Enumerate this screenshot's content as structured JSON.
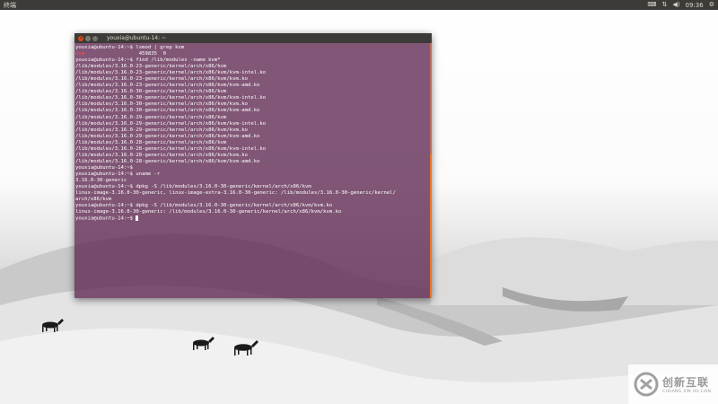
{
  "top_panel": {
    "app_name": "终端",
    "time": "09:36",
    "icons": [
      "keyboard-icon",
      "network-icon",
      "volume-icon",
      "power-icon"
    ]
  },
  "terminal": {
    "title": "youxia@ubuntu-14: ~",
    "lines": [
      {
        "parts": [
          {
            "t": "youxia@ubuntu-14:~$ lsmod | grep kvm"
          }
        ]
      },
      {
        "parts": [
          {
            "t": "kvm",
            "hl": true
          },
          {
            "t": "                  459835  0"
          }
        ]
      },
      {
        "parts": [
          {
            "t": "youxia@ubuntu-14:~$ find /lib/modules -name kvm*"
          }
        ]
      },
      {
        "parts": [
          {
            "t": "/lib/modules/3.16.0-23-generic/kernel/arch/x86/kvm"
          }
        ]
      },
      {
        "parts": [
          {
            "t": "/lib/modules/3.16.0-23-generic/kernel/arch/x86/kvm/kvm-intel.ko"
          }
        ]
      },
      {
        "parts": [
          {
            "t": "/lib/modules/3.16.0-23-generic/kernel/arch/x86/kvm/kvm.ko"
          }
        ]
      },
      {
        "parts": [
          {
            "t": "/lib/modules/3.16.0-23-generic/kernel/arch/x86/kvm/kvm-amd.ko"
          }
        ]
      },
      {
        "parts": [
          {
            "t": "/lib/modules/3.16.0-30-generic/kernel/arch/x86/kvm"
          }
        ]
      },
      {
        "parts": [
          {
            "t": "/lib/modules/3.16.0-30-generic/kernel/arch/x86/kvm/kvm-intel.ko"
          }
        ]
      },
      {
        "parts": [
          {
            "t": "/lib/modules/3.16.0-30-generic/kernel/arch/x86/kvm/kvm.ko"
          }
        ]
      },
      {
        "parts": [
          {
            "t": "/lib/modules/3.16.0-30-generic/kernel/arch/x86/kvm/kvm-amd.ko"
          }
        ]
      },
      {
        "parts": [
          {
            "t": "/lib/modules/3.16.0-29-generic/kernel/arch/x86/kvm"
          }
        ]
      },
      {
        "parts": [
          {
            "t": "/lib/modules/3.16.0-29-generic/kernel/arch/x86/kvm/kvm-intel.ko"
          }
        ]
      },
      {
        "parts": [
          {
            "t": "/lib/modules/3.16.0-29-generic/kernel/arch/x86/kvm/kvm.ko"
          }
        ]
      },
      {
        "parts": [
          {
            "t": "/lib/modules/3.16.0-29-generic/kernel/arch/x86/kvm/kvm-amd.ko"
          }
        ]
      },
      {
        "parts": [
          {
            "t": "/lib/modules/3.16.0-28-generic/kernel/arch/x86/kvm"
          }
        ]
      },
      {
        "parts": [
          {
            "t": "/lib/modules/3.16.0-28-generic/kernel/arch/x86/kvm/kvm-intel.ko"
          }
        ]
      },
      {
        "parts": [
          {
            "t": "/lib/modules/3.16.0-28-generic/kernel/arch/x86/kvm/kvm.ko"
          }
        ]
      },
      {
        "parts": [
          {
            "t": "/lib/modules/3.16.0-28-generic/kernel/arch/x86/kvm/kvm-amd.ko"
          }
        ]
      },
      {
        "parts": [
          {
            "t": "youxia@ubuntu-14:~$"
          }
        ]
      },
      {
        "parts": [
          {
            "t": "youxia@ubuntu-14:~$ uname -r"
          }
        ]
      },
      {
        "parts": [
          {
            "t": "3.16.0-30-generic"
          }
        ]
      },
      {
        "parts": [
          {
            "t": "youxia@ubuntu-14:~$ dpkg -S /lib/modules/3.16.0-30-generic/kernel/arch/x86/kvm"
          }
        ]
      },
      {
        "parts": [
          {
            "t": "linux-image-3.16.0-30-generic, linux-image-extra-3.16.0-30-generic: /lib/modules/3.16.0-30-generic/kernel/"
          }
        ]
      },
      {
        "parts": [
          {
            "t": "arch/x86/kvm"
          }
        ]
      },
      {
        "parts": [
          {
            "t": "youxia@ubuntu-14:~$ dpkg -S /lib/modules/3.16.0-30-generic/kernel/arch/x86/kvm/kvm.ko"
          }
        ]
      },
      {
        "parts": [
          {
            "t": "linux-image-3.16.0-30-generic: /lib/modules/3.16.0-30-generic/kernel/arch/x86/kvm/kvm.ko"
          }
        ]
      },
      {
        "parts": [
          {
            "t": "youxia@ubuntu-14:~$ "
          }
        ],
        "cursor": true
      }
    ]
  },
  "watermark": {
    "cn": "创新互联",
    "en": "CHUANG XIN HU LIAN"
  }
}
